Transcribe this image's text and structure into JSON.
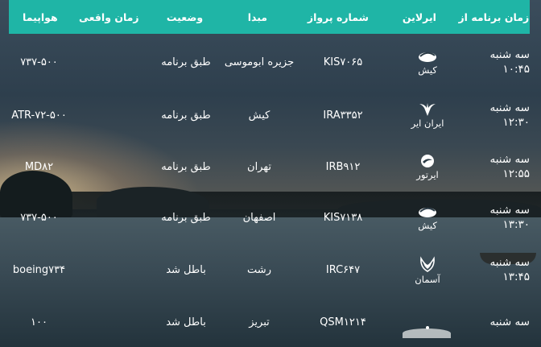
{
  "header": {
    "scheduled_time": "زمان برنامه از",
    "airline": "ایرلاین",
    "flight_number": "شماره پرواز",
    "origin": "مبدا",
    "status": "وضعیت",
    "actual_time": "زمان واقعی",
    "aircraft": "هواپیما"
  },
  "flights": [
    {
      "day": "سه شنبه",
      "time": "۱۰:۴۵",
      "airline": "کیش",
      "logo_icon": "kish-air-logo-icon",
      "flight": "KIS۷۰۶۵",
      "origin": "جزیره ابوموسی",
      "status": "طبق برنامه",
      "actual": "",
      "aircraft": "۷۳۷-۵۰۰"
    },
    {
      "day": "سه شنبه",
      "time": "۱۲:۳۰",
      "airline": "ایران ایر",
      "logo_icon": "iran-air-logo-icon",
      "flight": "IRA۳۳۵۲",
      "origin": "کیش",
      "status": "طبق برنامه",
      "actual": "",
      "aircraft": "ATR-۷۲-۵۰۰"
    },
    {
      "day": "سه شنبه",
      "time": "۱۲:۵۵",
      "airline": "ایرتور",
      "logo_icon": "iran-airtour-logo-icon",
      "flight": "IRB۹۱۲",
      "origin": "تهران",
      "status": "طبق برنامه",
      "actual": "",
      "aircraft": "MD۸۲"
    },
    {
      "day": "سه شنبه",
      "time": "۱۳:۳۰",
      "airline": "کیش",
      "logo_icon": "kish-air-logo-icon",
      "flight": "KIS۷۱۳۸",
      "origin": "اصفهان",
      "status": "طبق برنامه",
      "actual": "",
      "aircraft": "۷۳۷-۵۰۰"
    },
    {
      "day": "سه شنبه",
      "time": "۱۳:۴۵",
      "airline": "آسمان",
      "logo_icon": "aseman-logo-icon",
      "flight": "IRC۶۴۷",
      "origin": "رشت",
      "status": "باطل شد",
      "actual": "",
      "aircraft": "boeing۷۳۴"
    },
    {
      "day": "سه شنبه",
      "time": "",
      "airline": "",
      "logo_icon": "qeshm-air-logo-icon",
      "flight": "QSM۱۲۱۴",
      "origin": "تبریز",
      "status": "باطل شد",
      "actual": "",
      "aircraft": "۱۰۰"
    }
  ],
  "colors": {
    "header_bg": "#1fb5a6",
    "text": "#ffffff"
  }
}
